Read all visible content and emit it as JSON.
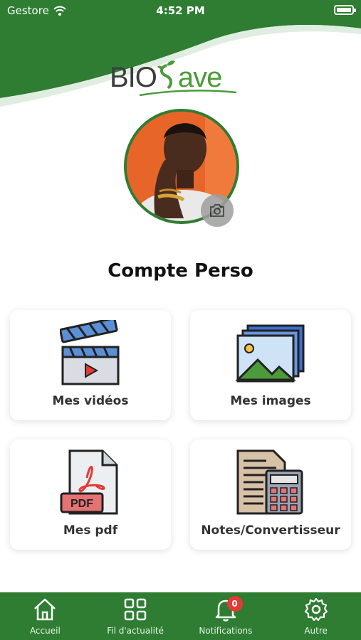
{
  "status_bar": {
    "carrier": "Gestore",
    "time": "4:52 PM",
    "battery_level": 1.0
  },
  "logo": {
    "part1": "BIO",
    "part2": "ave",
    "alt": "BIOSave"
  },
  "colors": {
    "primary": "#2e7d32",
    "accent": "#4b9b3a",
    "badge": "#e53935"
  },
  "profile": {
    "title": "Compte Perso",
    "avatar_icon": "user-photo",
    "camera_icon": "camera-icon"
  },
  "cards": [
    {
      "label": "Mes vidéos",
      "icon": "clapperboard-icon"
    },
    {
      "label": "Mes images",
      "icon": "images-icon"
    },
    {
      "label": "Mes pdf",
      "icon": "pdf-file-icon"
    },
    {
      "label": "Notes/Convertisseur",
      "icon": "calculator-notes-icon"
    }
  ],
  "tabs": [
    {
      "label": "Accueil",
      "icon": "home-icon"
    },
    {
      "label": "Fil d'actualité",
      "icon": "grid-icon"
    },
    {
      "label": "Notifications",
      "icon": "bell-icon",
      "badge": "0"
    },
    {
      "label": "Autre",
      "icon": "gear-icon"
    }
  ]
}
